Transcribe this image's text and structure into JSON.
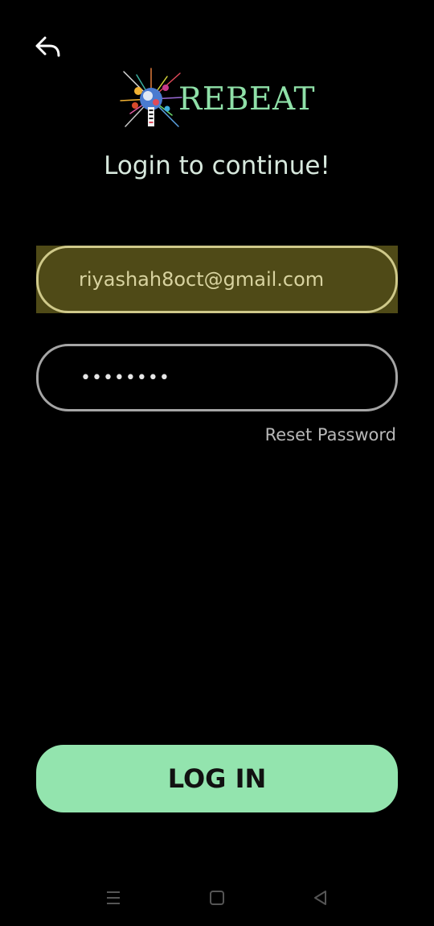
{
  "header": {
    "back_icon": "back-arrow-icon"
  },
  "brand": {
    "logo_icon": "rebeat-logo",
    "name": "REBEAT",
    "accent_color": "#8fe0a8"
  },
  "subtitle": "Login to continue!",
  "form": {
    "email_value": "riyashah8oct@gmail.com",
    "password_value": "••••••••",
    "reset_label": "Reset Password",
    "login_label": "LOG IN",
    "button_color": "#93e4ae"
  },
  "system_nav": {
    "menu_icon": "menu-lines-icon",
    "home_icon": "square-home-icon",
    "back_icon": "triangle-back-icon"
  }
}
